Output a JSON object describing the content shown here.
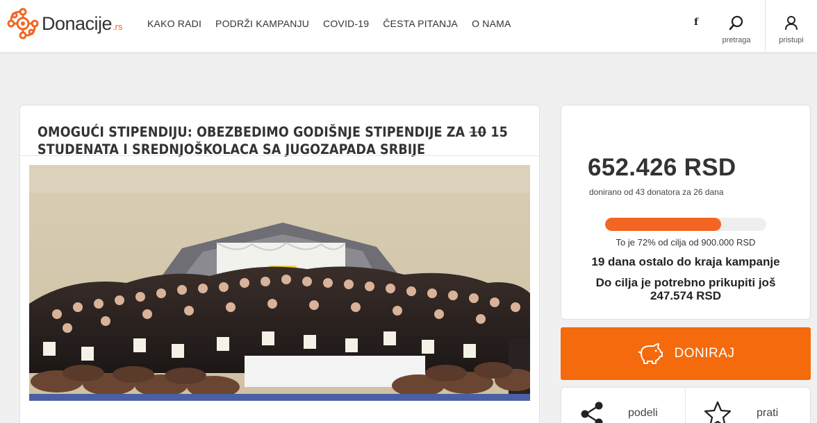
{
  "header": {
    "logo_text": "Donacije",
    "logo_suffix": ".rs",
    "nav": [
      {
        "label": "KAKO RADI"
      },
      {
        "label": "PODRŽI KAMPANJU"
      },
      {
        "label": "COVID-19"
      },
      {
        "label": "ČESTA PITANJA"
      },
      {
        "label": "O NAMA"
      }
    ],
    "facebook_label": "f",
    "search_label": "pretraga",
    "login_label": "pristupi"
  },
  "campaign": {
    "title_part1": "OMOGUĆI STIPENDIJU: OBEZBEDIMO GODIŠNJE STIPENDIJE ZA ",
    "title_strike": "10",
    "title_part2": " 15 STUDENATA I SREDNJOŠKOLACA SA JUGOZAPADA SRBIJE"
  },
  "stats": {
    "amount": "652.426 RSD",
    "amount_sub": "donirano od 43 donatora za 26 dana",
    "progress_fraction": 0.72,
    "progress_text": "To je 72% od cilja od 900.000 RSD",
    "days_left": "19 dana ostalo do kraja kampanje",
    "remaining_line1": "Do cilja je potrebno prikupiti još",
    "remaining_line2": "247.574 RSD"
  },
  "donate": {
    "label": "DONIRAJ"
  },
  "actions": {
    "share_label": "podeli",
    "follow_label": "prati"
  },
  "colors": {
    "accent": "#f26522",
    "donate": "#f46a0d",
    "photo_bar": "#4a5fa5"
  }
}
